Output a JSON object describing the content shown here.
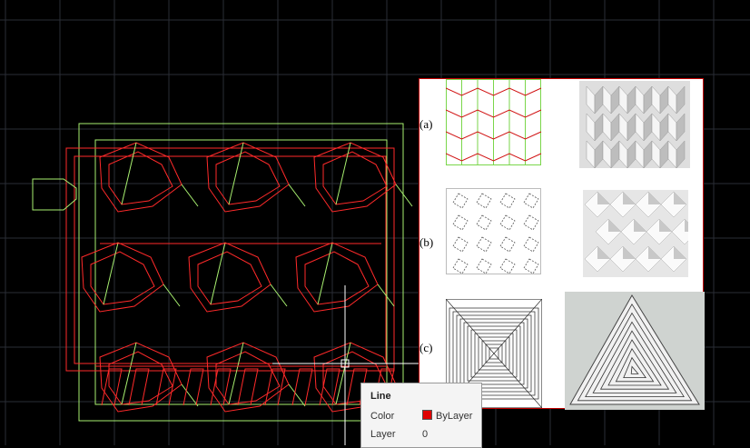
{
  "figure": {
    "labels": [
      "(a)",
      "(b)",
      "(c)"
    ]
  },
  "tooltip": {
    "title": "Line",
    "rows": [
      {
        "label": "Color",
        "value": "ByLayer",
        "swatch": "#e00000"
      },
      {
        "label": "Layer",
        "value": "0"
      }
    ]
  },
  "colors": {
    "background": "#000000",
    "grid": "#2a2e36",
    "cut_lines": "#ff2a2a",
    "fold_lines": "#a8f070",
    "panel_border": "#c00000"
  },
  "icons": [
    "crosshair-cursor-icon"
  ]
}
